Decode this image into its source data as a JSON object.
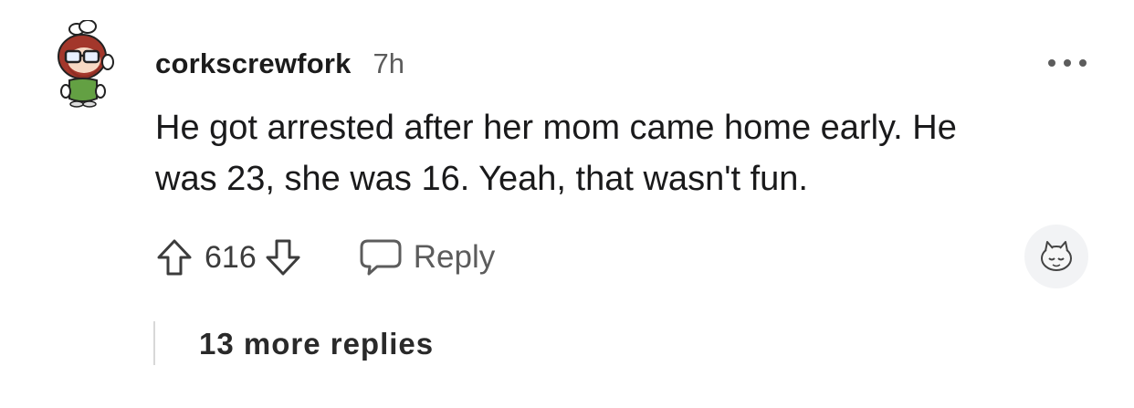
{
  "comment": {
    "author": "corkscrewfork",
    "age": "7h",
    "body_lines": [
      "He got arrested after her mom came home early. He",
      "was 23, she was 16. Yeah, that wasn't fun."
    ],
    "score": "616",
    "reply_label": "Reply",
    "more_replies_label": "13 more replies"
  },
  "icons": {
    "avatar": "snoo-avatar-icon",
    "more": "more-options-icon",
    "upvote": "upvote-arrow-icon",
    "downvote": "downvote-arrow-icon",
    "reply": "chat-bubble-icon",
    "award": "award-snoo-icon"
  },
  "colors": {
    "text": "#1a1a1b",
    "muted": "#5c5c5c",
    "thread_line": "#d8d8d8",
    "award_bg": "#f2f3f5"
  }
}
